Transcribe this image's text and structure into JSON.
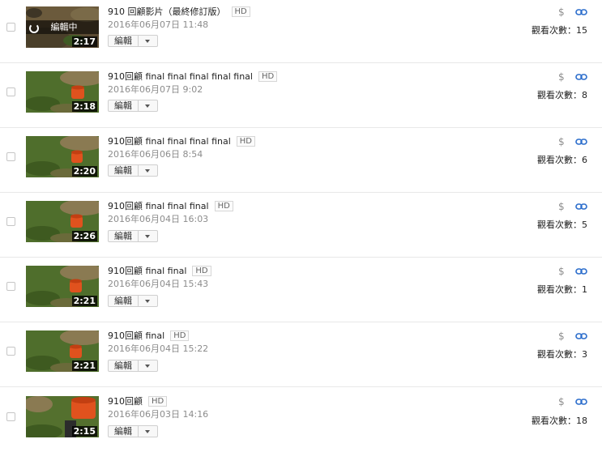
{
  "common": {
    "edit_label": "編輯",
    "hd_label": "HD",
    "views_label": "觀看次數："
  },
  "colors": {
    "link_icon": "#2b6dcc",
    "dollar_icon": "#8e8e8e",
    "grass": "#4f6e2c",
    "bucket": "#e0521e"
  },
  "videos": [
    {
      "title": "910 回顧影片（最終修訂版）",
      "date": "2016年06月07日 11:48",
      "duration": "2:17",
      "views": "15",
      "editing_status": "編輯中",
      "thumbnail": "ground-closeup"
    },
    {
      "title": "910回顧 final final final final final",
      "date": "2016年06月07日 9:02",
      "duration": "2:18",
      "views": "8",
      "thumbnail": "bucket-on-grass"
    },
    {
      "title": "910回顧 final final final final",
      "date": "2016年06月06日 8:54",
      "duration": "2:20",
      "views": "6",
      "thumbnail": "bucket-on-grass"
    },
    {
      "title": "910回顧 final final final",
      "date": "2016年06月04日 16:03",
      "duration": "2:26",
      "views": "5",
      "thumbnail": "bucket-on-grass"
    },
    {
      "title": "910回顧 final final",
      "date": "2016年06月04日 15:43",
      "duration": "2:21",
      "views": "1",
      "thumbnail": "bucket-on-grass"
    },
    {
      "title": "910回顧 final",
      "date": "2016年06月04日 15:22",
      "duration": "2:21",
      "views": "3",
      "thumbnail": "bucket-on-grass"
    },
    {
      "title": "910回顧",
      "date": "2016年06月03日 14:16",
      "duration": "2:15",
      "views": "18",
      "thumbnail": "bucket-closeup"
    }
  ]
}
